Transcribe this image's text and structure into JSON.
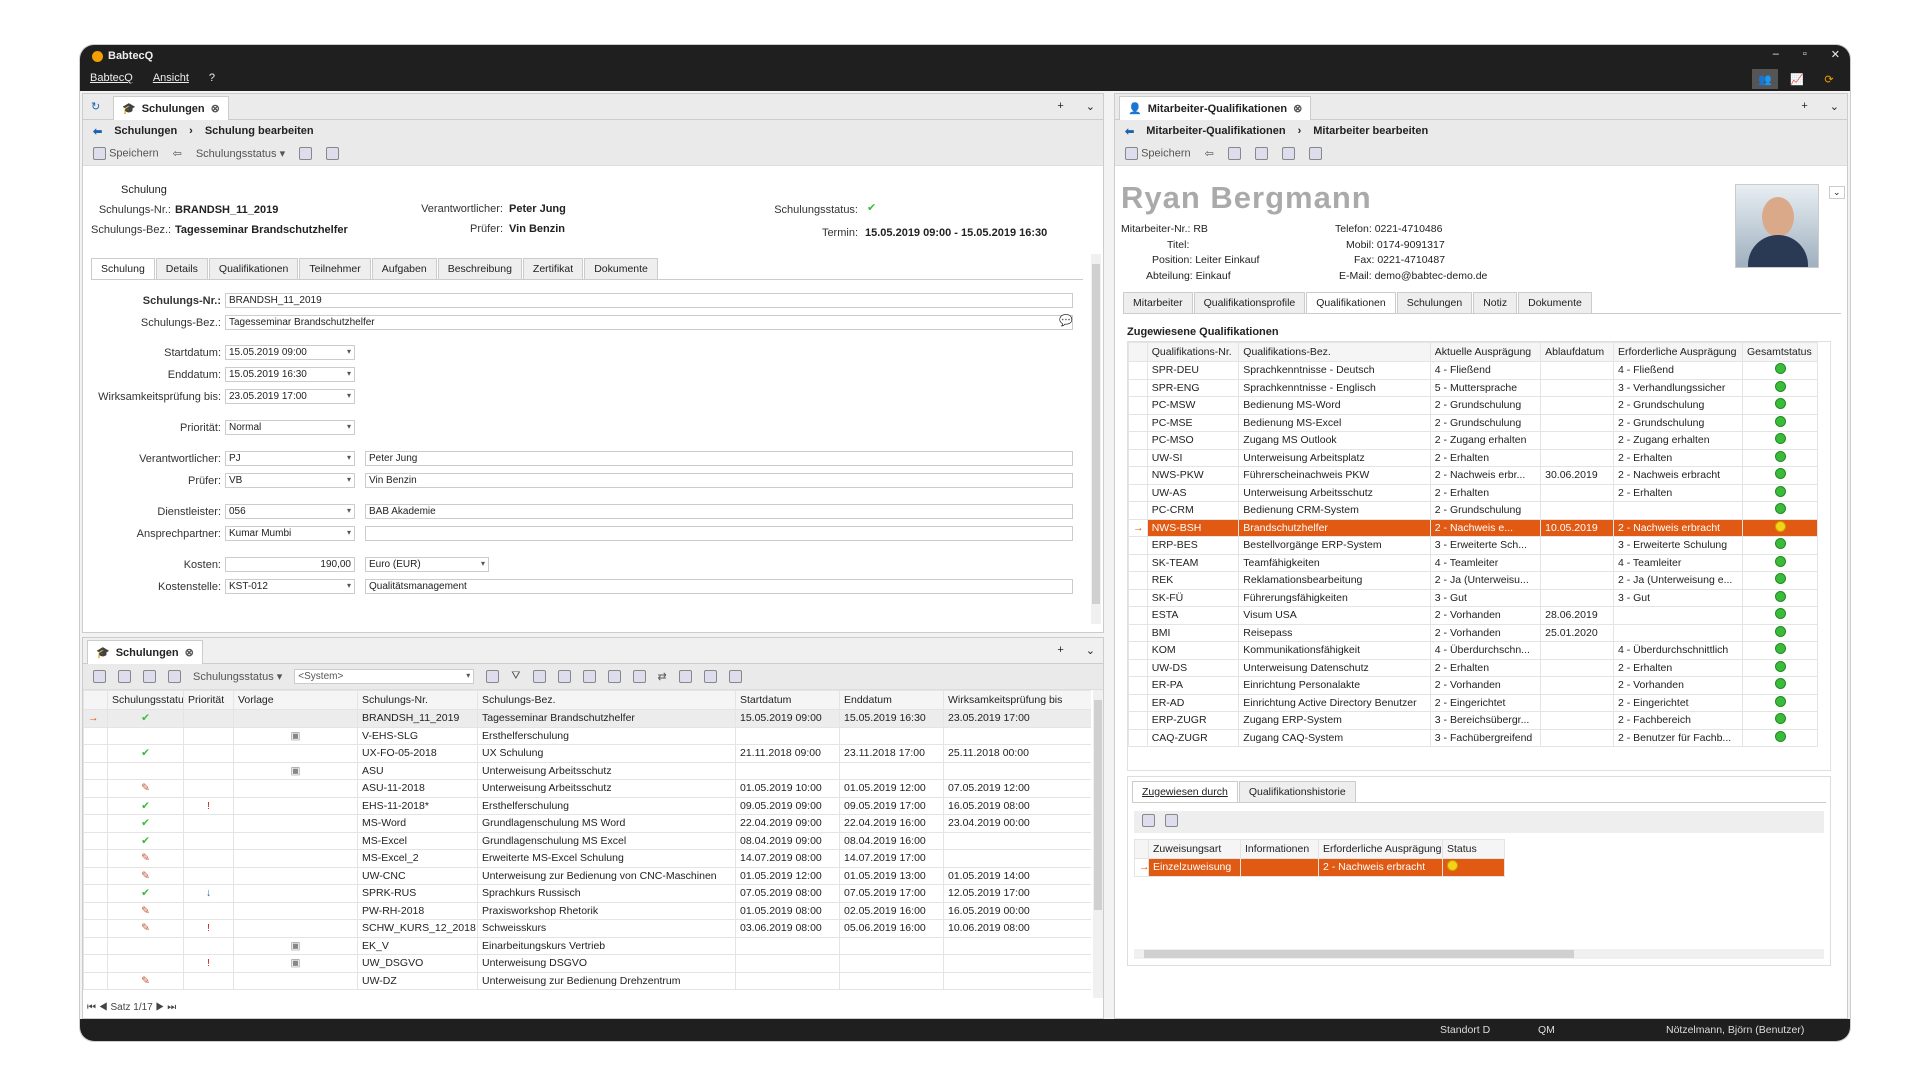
{
  "app": {
    "title": "BabtecQ",
    "menu": [
      "BabtecQ",
      "Ansicht",
      "?"
    ],
    "window_controls": [
      "–",
      "▫",
      "✕"
    ]
  },
  "left": {
    "tab": "Schulungen",
    "breadcrumb": [
      "Schulungen",
      "Schulung bearbeiten"
    ],
    "toolbar": {
      "save": "Speichern",
      "status": "Schulungsstatus"
    },
    "header": {
      "section": "Schulung",
      "nr_label": "Schulungs-Nr.:",
      "nr": "BRANDSH_11_2019",
      "bez_label": "Schulungs-Bez.:",
      "bez": "Tagesseminar Brandschutzhelfer",
      "verant_label": "Verantwortlicher:",
      "verant": "Peter Jung",
      "pruefer_label": "Prüfer:",
      "pruefer": "Vin Benzin",
      "status_label": "Schulungsstatus:",
      "termin_label": "Termin:",
      "termin": "15.05.2019 09:00 - 15.05.2019 16:30"
    },
    "tabs": [
      "Schulung",
      "Details",
      "Qualifikationen",
      "Teilnehmer",
      "Aufgaben",
      "Beschreibung",
      "Zertifikat",
      "Dokumente"
    ],
    "form": {
      "nr_label": "Schulungs-Nr.:",
      "nr": "BRANDSH_11_2019",
      "bez_label": "Schulungs-Bez.:",
      "bez": "Tagesseminar Brandschutzhelfer",
      "start_label": "Startdatum:",
      "start": "15.05.2019 09:00",
      "end_label": "Enddatum:",
      "end": "15.05.2019 16:30",
      "wirk_label": "Wirksamkeitsprüfung bis:",
      "wirk": "23.05.2019 17:00",
      "prio_label": "Priorität:",
      "prio": "Normal",
      "verant_label": "Verantwortlicher:",
      "verant_code": "PJ",
      "verant_name": "Peter Jung",
      "pruefer_label": "Prüfer:",
      "pruefer_code": "VB",
      "pruefer_name": "Vin Benzin",
      "dienst_label": "Dienstleister:",
      "dienst_code": "056",
      "dienst_name": "BAB Akademie",
      "ansprech_label": "Ansprechpartner:",
      "ansprech": "Kumar Mumbi",
      "kosten_label": "Kosten:",
      "kosten": "190,00",
      "waehrung": "Euro (EUR)",
      "kst_label": "Kostenstelle:",
      "kst": "KST-012",
      "kst_name": "Qualitätsmanagement"
    }
  },
  "list": {
    "tab": "Schulungen",
    "status": "Schulungsstatus",
    "system": "<System>",
    "footer": "Satz 1/17",
    "columns": [
      "Schulungsstatus",
      "Priorität",
      "Vorlage",
      "Schulungs-Nr.",
      "Schulungs-Bez.",
      "Startdatum",
      "Enddatum",
      "Wirksamkeitsprüfung bis"
    ],
    "rows": [
      [
        "BRANDSH_11_2019",
        "Tagesseminar Brandschutzhelfer",
        "15.05.2019 09:00",
        "15.05.2019 16:30",
        "23.05.2019 17:00"
      ],
      [
        "V-EHS-SLG",
        "Ersthelferschulung",
        "",
        "",
        ""
      ],
      [
        "UX-FO-05-2018",
        "UX Schulung",
        "21.11.2018 09:00",
        "23.11.2018 17:00",
        "25.11.2018 00:00"
      ],
      [
        "ASU",
        "Unterweisung Arbeitsschutz",
        "",
        "",
        ""
      ],
      [
        "ASU-11-2018",
        "Unterweisung Arbeitsschutz",
        "01.05.2019 10:00",
        "01.05.2019 12:00",
        "07.05.2019 12:00"
      ],
      [
        "EHS-11-2018*",
        "Ersthelferschulung",
        "09.05.2019 09:00",
        "09.05.2019 17:00",
        "16.05.2019 08:00"
      ],
      [
        "MS-Word",
        "Grundlagenschulung MS Word",
        "22.04.2019 09:00",
        "22.04.2019 16:00",
        "23.04.2019 00:00"
      ],
      [
        "MS-Excel",
        "Grundlagenschulung MS Excel",
        "08.04.2019 09:00",
        "08.04.2019 16:00",
        ""
      ],
      [
        "MS-Excel_2",
        "Erweiterte MS-Excel Schulung",
        "14.07.2019 08:00",
        "14.07.2019 17:00",
        ""
      ],
      [
        "UW-CNC",
        "Unterweisung zur Bedienung von CNC-Maschinen",
        "01.05.2019 12:00",
        "01.05.2019 13:00",
        "01.05.2019 14:00"
      ],
      [
        "SPRK-RUS",
        "Sprachkurs Russisch",
        "07.05.2019 08:00",
        "07.05.2019 17:00",
        "12.05.2019 17:00"
      ],
      [
        "PW-RH-2018",
        "Praxisworkshop Rhetorik",
        "01.05.2019 08:00",
        "02.05.2019 16:00",
        "16.05.2019 00:00"
      ],
      [
        "SCHW_KURS_12_2018",
        "Schweisskurs",
        "03.06.2019 08:00",
        "05.06.2019 16:00",
        "10.06.2019 08:00"
      ],
      [
        "EK_V",
        "Einarbeitungskurs Vertrieb",
        "",
        "",
        ""
      ],
      [
        "UW_DSGVO",
        "Unterweisung DSGVO",
        "",
        "",
        ""
      ],
      [
        "UW-DZ",
        "Unterweisung zur Bedienung Drehzentrum",
        "",
        "",
        ""
      ]
    ]
  },
  "right": {
    "tab": "Mitarbeiter-Qualifikationen",
    "breadcrumb": [
      "Mitarbeiter-Qualifikationen",
      "Mitarbeiter bearbeiten"
    ],
    "toolbar": {
      "save": "Speichern"
    },
    "name": "Ryan Bergmann",
    "info": [
      "Mitarbeiter-Nr.: RB",
      "Titel:",
      "Position: Leiter Einkauf",
      "Abteilung: Einkauf"
    ],
    "contact": [
      "Telefon: 0221-4710486",
      "Mobil: 0174-9091317",
      "Fax: 0221-4710487",
      "E-Mail: demo@babtec-demo.de"
    ],
    "tabs": [
      "Mitarbeiter",
      "Qualifikationsprofile",
      "Qualifikationen",
      "Schulungen",
      "Notiz",
      "Dokumente"
    ],
    "section": "Zugewiesene Qualifikationen",
    "columns": [
      "Qualifikations-Nr.",
      "Qualifikations-Bez.",
      "Aktuelle Ausprägung",
      "Ablaufdatum",
      "Erforderliche Ausprägung",
      "Gesamtstatus"
    ],
    "rows": [
      [
        "SPR-DEU",
        "Sprachkenntnisse - Deutsch",
        "4 - Fließend",
        "",
        "4 - Fließend"
      ],
      [
        "SPR-ENG",
        "Sprachkenntnisse - Englisch",
        "5 - Muttersprache",
        "",
        "3 - Verhandlungssicher"
      ],
      [
        "PC-MSW",
        "Bedienung MS-Word",
        "2 - Grundschulung",
        "",
        "2 - Grundschulung"
      ],
      [
        "PC-MSE",
        "Bedienung MS-Excel",
        "2 - Grundschulung",
        "",
        "2 - Grundschulung"
      ],
      [
        "PC-MSO",
        "Zugang MS Outlook",
        "2 - Zugang erhalten",
        "",
        "2 - Zugang erhalten"
      ],
      [
        "UW-SI",
        "Unterweisung Arbeitsplatz",
        "2 - Erhalten",
        "",
        "2 - Erhalten"
      ],
      [
        "NWS-PKW",
        "Führerscheinachweis PKW",
        "2 - Nachweis erbr...",
        "30.06.2019",
        "2 - Nachweis erbracht"
      ],
      [
        "UW-AS",
        "Unterweisung Arbeitsschutz",
        "2 - Erhalten",
        "",
        "2 - Erhalten"
      ],
      [
        "PC-CRM",
        "Bedienung CRM-System",
        "2 - Grundschulung",
        "",
        ""
      ],
      [
        "NWS-BSH",
        "Brandschutzhelfer",
        "2 - Nachweis e...",
        "10.05.2019",
        "2 - Nachweis erbracht"
      ],
      [
        "ERP-BES",
        "Bestellvorgänge ERP-System",
        "3 - Erweiterte Sch...",
        "",
        "3 - Erweiterte Schulung"
      ],
      [
        "SK-TEAM",
        "Teamfähigkeiten",
        "4 - Teamleiter",
        "",
        "4 - Teamleiter"
      ],
      [
        "REK",
        "Reklamationsbearbeitung",
        "2 - Ja (Unterweisu...",
        "",
        "2 - Ja (Unterweisung e..."
      ],
      [
        "SK-FÜ",
        "Führerungsfähigkeiten",
        "3 - Gut",
        "",
        "3 - Gut"
      ],
      [
        "ESTA",
        "Visum USA",
        "2 - Vorhanden",
        "28.06.2019",
        ""
      ],
      [
        "BMI",
        "Reisepass",
        "2 - Vorhanden",
        "25.01.2020",
        ""
      ],
      [
        "KOM",
        "Kommunikationsfähigkeit",
        "4 - Überdurchschn...",
        "",
        "4 - Überdurchschnittlich"
      ],
      [
        "UW-DS",
        "Unterweisung Datenschutz",
        "2 - Erhalten",
        "",
        "2 - Erhalten"
      ],
      [
        "ER-PA",
        "Einrichtung Personalakte",
        "2 - Vorhanden",
        "",
        "2 - Vorhanden"
      ],
      [
        "ER-AD",
        "Einrichtung Active Directory Benutzer",
        "2 - Eingerichtet",
        "",
        "2 - Eingerichtet"
      ],
      [
        "ERP-ZUGR",
        "Zugang ERP-System",
        "3 - Bereichsübergr...",
        "",
        "2 - Fachbereich"
      ],
      [
        "CAQ-ZUGR",
        "Zugang CAQ-System",
        "3 - Fachübergreifend",
        "",
        "2 - Benutzer für Fachb..."
      ]
    ],
    "subtabs": [
      "Zugewiesen durch",
      "Qualifikationshistorie"
    ],
    "sub_columns": [
      "Zuweisungsart",
      "Informationen",
      "Erforderliche Ausprägung",
      "Status"
    ],
    "sub_row": [
      "Einzelzuweisung",
      "",
      "2 - Nachweis erbracht"
    ]
  },
  "status": {
    "standort": "Standort D",
    "qm": "QM",
    "user": "Nötzelmann, Björn (Benutzer)"
  },
  "colors": {
    "selected": "#e05a14",
    "accent": "#f0a000",
    "ok": "#3bbb3b"
  }
}
